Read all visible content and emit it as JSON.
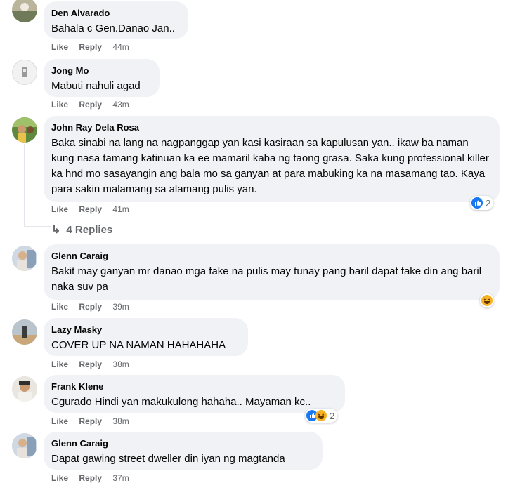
{
  "comments": [
    {
      "author": "Den Alvarado",
      "text": "Bahala c Gen.Danao Jan..",
      "like": "Like",
      "reply": "Reply",
      "time": "44m"
    },
    {
      "author": "Jong Mo",
      "text": "Mabuti nahuli agad",
      "like": "Like",
      "reply": "Reply",
      "time": "43m"
    },
    {
      "author": "John Ray Dela Rosa",
      "text": "Baka sinabi na lang na nagpanggap yan kasi kasiraan sa kapulusan yan.. ikaw ba naman kung nasa tamang katinuan ka ee mamaril kaba ng taong grasa. Saka kung professional killer ka hnd mo sasayangin ang bala mo sa ganyan at para mabuking ka na masamang tao. Kaya para sakin malamang sa alamang pulis yan.",
      "like": "Like",
      "reply": "Reply",
      "time": "41m",
      "reaction_count": "2",
      "replies": "4 Replies"
    },
    {
      "author": "Glenn Caraig",
      "text": "Bakit may ganyan mr danao mga fake na pulis may tunay pang baril dapat fake din ang baril naka suv pa",
      "like": "Like",
      "reply": "Reply",
      "time": "39m"
    },
    {
      "author": "Lazy Masky",
      "text": "COVER UP NA NAMAN HAHAHAHA",
      "like": "Like",
      "reply": "Reply",
      "time": "38m"
    },
    {
      "author": "Frank Klene",
      "text": "Cgurado Hindi yan makukulong hahaha.. Mayaman kc..",
      "like": "Like",
      "reply": "Reply",
      "time": "38m",
      "reaction_count": "2"
    },
    {
      "author": "Glenn Caraig",
      "text": "Dapat gawing street dweller din iyan ng magtanda",
      "like": "Like",
      "reply": "Reply",
      "time": "37m"
    }
  ],
  "colors": {
    "bubble": "#f0f2f5",
    "meta": "#65676b",
    "like_blue": "#1877f2",
    "haha_yellow": "#f7b125"
  }
}
